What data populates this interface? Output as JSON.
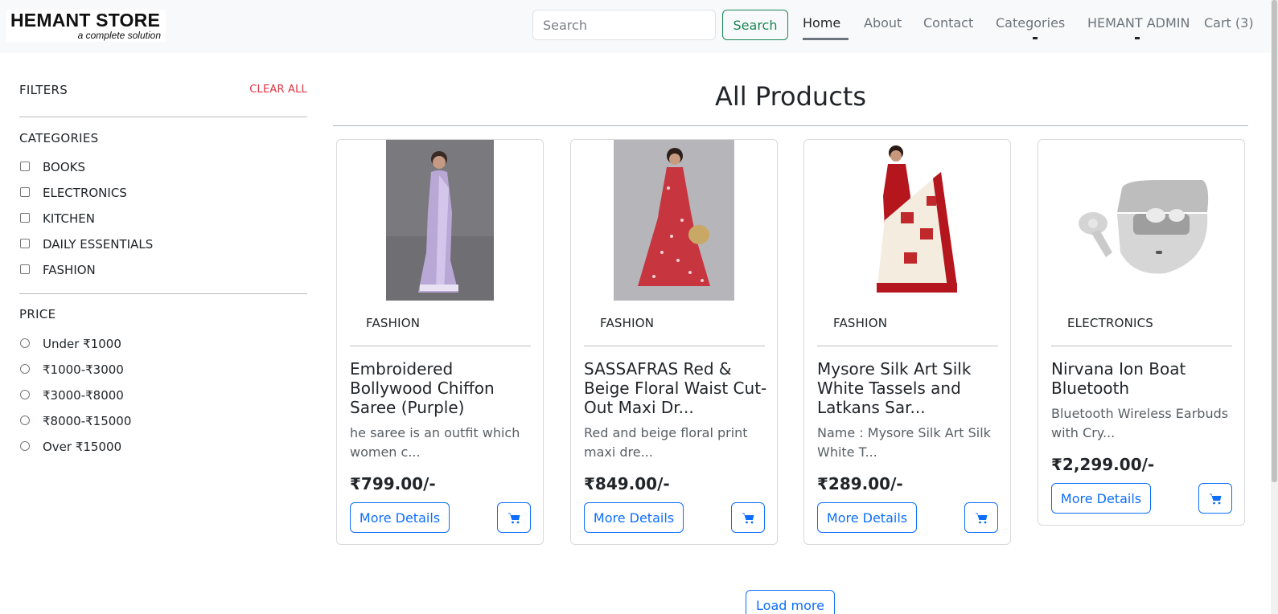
{
  "brand": {
    "name": "HEMANT STORE",
    "tagline": "a complete solution"
  },
  "nav": {
    "search_placeholder": "Search",
    "search_button": "Search",
    "links": [
      "Home",
      "About",
      "Contact",
      "Categories",
      "HEMANT ADMIN",
      "Cart (3)"
    ],
    "active": "Home"
  },
  "sidebar": {
    "filters_title": "FILTERS",
    "clear_all": "CLEAR ALL",
    "categories_title": "CATEGORIES",
    "categories": [
      "BOOKS",
      "ELECTRONICS",
      "KITCHEN",
      "DAILY ESSENTIALS",
      "FASHION"
    ],
    "price_title": "PRICE",
    "prices": [
      "Under ₹1000",
      "₹1000-₹3000",
      "₹3000-₹8000",
      "₹8000-₹15000",
      "Over ₹15000"
    ]
  },
  "main": {
    "title": "All Products",
    "products": [
      {
        "category": "FASHION",
        "name": "Embroidered Bollywood Chiffon Saree (Purple)",
        "description": "he saree is an outfit which women c...",
        "price": "₹799.00/-",
        "details_label": "More Details",
        "image": "purple-saree-photo"
      },
      {
        "category": "FASHION",
        "name": "SASSAFRAS Red & Beige Floral Waist Cut-Out Maxi Dr...",
        "description": "Red and beige floral print maxi dre...",
        "price": "₹849.00/-",
        "details_label": "More Details",
        "image": "red-maxi-dress-photo"
      },
      {
        "category": "FASHION",
        "name": "Mysore Silk Art Silk White Tassels and Latkans Sar...",
        "description": "Name : Mysore Silk Art Silk White T...",
        "price": "₹289.00/-",
        "details_label": "More Details",
        "image": "red-white-silk-saree-photo"
      },
      {
        "category": "ELECTRONICS",
        "name": "Nirvana Ion Boat Bluetooth",
        "description": "Bluetooth Wireless Earbuds with Cry...",
        "price": "₹2,299.00/-",
        "details_label": "More Details",
        "image": "grey-earbuds-case-photo"
      }
    ],
    "load_more": "Load more"
  },
  "colors": {
    "primary": "#0d6efd",
    "success": "#198754",
    "danger": "#dc3545",
    "navbar_bg": "#f8f9fa"
  }
}
